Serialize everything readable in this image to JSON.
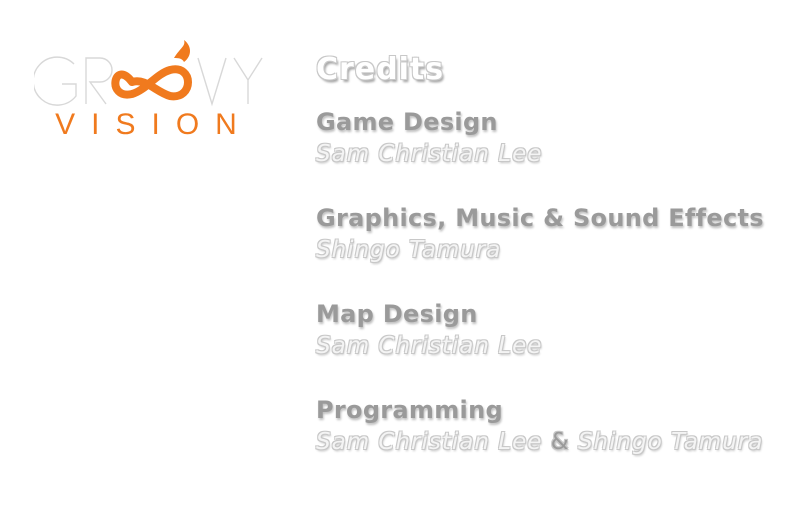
{
  "logo": {
    "top_text": "GROOVY",
    "bottom_text": "VISION",
    "accent_color": "#f07a1e",
    "outline_color": "#d8d8d8"
  },
  "credits": {
    "title": "Credits",
    "sections": [
      {
        "role": "Game Design",
        "names": [
          "Sam Christian Lee"
        ]
      },
      {
        "role": "Graphics, Music & Sound Effects",
        "names": [
          "Shingo Tamura"
        ]
      },
      {
        "role": "Map Design",
        "names": [
          "Sam Christian Lee"
        ]
      },
      {
        "role": "Programming",
        "names": [
          "Sam Christian Lee",
          "Shingo Tamura"
        ],
        "joiner": "&"
      }
    ]
  }
}
